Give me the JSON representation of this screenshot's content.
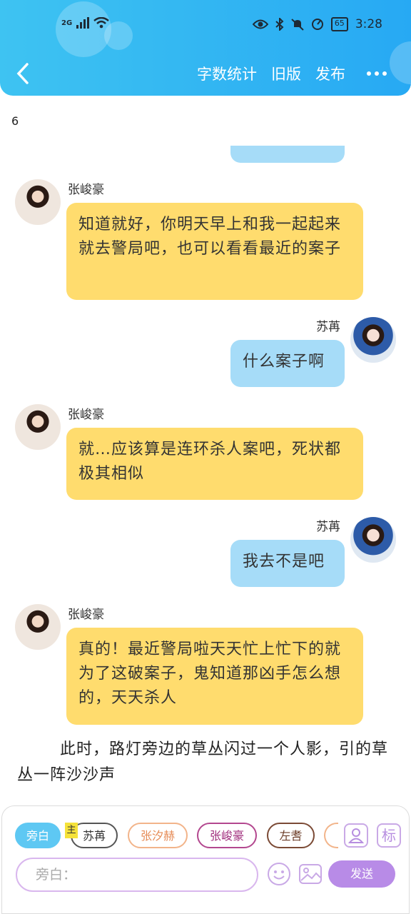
{
  "status_bar": {
    "network": "2G",
    "time": "3:28",
    "battery": "65"
  },
  "nav": {
    "word_count": "字数统计",
    "old_version": "旧版",
    "publish": "发布"
  },
  "page_number": "6",
  "messages": [
    {
      "speaker": "张峻豪",
      "side": "left",
      "text": "知道就好，你明天早上和我一起起来就去警局吧，也可以看看最近的案子"
    },
    {
      "speaker": "苏苒",
      "side": "right",
      "text": "什么案子啊"
    },
    {
      "speaker": "张峻豪",
      "side": "left",
      "text": "就…应该算是连环杀人案吧，死状都极其相似"
    },
    {
      "speaker": "苏苒",
      "side": "right",
      "text": "我去不是吧"
    },
    {
      "speaker": "张峻豪",
      "side": "left",
      "text": "真的！最近警局啦天天忙上忙下的就为了这破案子，鬼知道那凶手怎么想的，天天杀人"
    }
  ],
  "narration": "此时，路灯旁边的草丛闪过一个人影，引的草丛一阵沙沙声",
  "characters": [
    "旁白",
    "苏苒",
    "张汐赫",
    "张峻豪",
    "左䎛"
  ],
  "master_badge": "主",
  "mark_label": "标",
  "input": {
    "placeholder": "旁白："
  },
  "send_label": "发送",
  "colors": {
    "header": "#27a9f3",
    "bubble_left": "#ffdc6e",
    "bubble_right": "#a6dcf8",
    "send": "#b88be7"
  }
}
